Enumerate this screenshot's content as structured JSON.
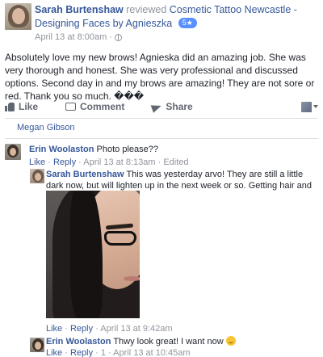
{
  "post": {
    "author": "Sarah Burtenshaw",
    "action": "reviewed",
    "page_name": "Cosmetic Tattoo Newcastle - Designing Faces by Agnieszka",
    "rating_badge": "5★",
    "timestamp": "April 13 at 8:00am",
    "separator": "·",
    "body": "Absolutely love my new brows! Agnieska did an amazing job. She was very thorough and honest. She was very professional and discussed options. Second day in and my brows are amazing! They are not sore or red. Thank you so much. ���"
  },
  "actions": {
    "like_label": "Like",
    "comment_label": "Comment",
    "share_label": "Share"
  },
  "liked_by": "Megan Gibson",
  "comments": [
    {
      "author": "Erin Woolaston",
      "text": "Photo please??",
      "like_label": "Like",
      "reply_label": "Reply",
      "timestamp": "April 13 at 8:13am",
      "edited_label": "Edited"
    },
    {
      "author": "Sarah Burtenshaw",
      "text": "This was yesterday arvo! They are still a little dark now, but will lighten up in the next week or so. Getting hair and make over next week.",
      "like_label": "Like",
      "reply_label": "Reply",
      "timestamp": "April 13 at 9:42am"
    },
    {
      "author": "Erin Woolaston",
      "text": "Thwy look great! I want now",
      "emoji": "smiling-face-emoji",
      "like_label": "Like",
      "reply_label": "Reply",
      "reaction_count": "1",
      "timestamp": "April 13 at 10:45am"
    }
  ],
  "colors": {
    "link": "#365899",
    "muted": "#90949c",
    "text": "#1d2129",
    "badge": "#5890ff",
    "divider": "#dddfe2"
  }
}
